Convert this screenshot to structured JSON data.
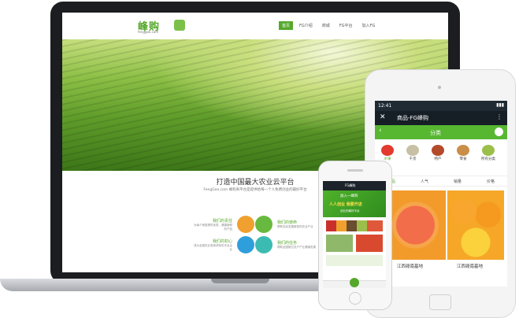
{
  "site": {
    "logo_text": "峰购",
    "logo_sub": "fenggoo.com",
    "nav": [
      "首页",
      "FG介绍",
      "商城",
      "FG平台",
      "加入FG"
    ],
    "tagline": "打造中国最大农业云平台",
    "subline": "FengGoo.com 峰购商平台是提供给每一个人免费创业的最好平台",
    "features": [
      {
        "title": "我们的责任",
        "desc": "为每个家庭提供优质、健康新鲜的产品"
      },
      {
        "title": "我们的使命",
        "desc": "帮助农民发展新型的农业产业"
      },
      {
        "title": "我们的初心",
        "desc": "成为全国农业电商领军的平台企业"
      },
      {
        "title": "我们的任务",
        "desc": "帮助全国数亿农户产业健康发展"
      }
    ],
    "colors": {
      "brand": "#56a82b",
      "orange": "#f0a02e",
      "teal": "#3bbbb1",
      "blue": "#2f9fdc",
      "green": "#68b93f"
    }
  },
  "tablet": {
    "time": "12:41",
    "title": "商品-FG峰购",
    "section": "分类",
    "categories": [
      "水果",
      "干货",
      "特产",
      "零食",
      "所有分类"
    ],
    "tabs": [
      "商品",
      "人气",
      "销量",
      "价格"
    ],
    "products": [
      "江西赣南基地",
      "江西赣南基地"
    ]
  },
  "phone": {
    "title": "FG峰购",
    "banner_line1": "加入一峰购",
    "banner_line2": "人人创业 我要开店",
    "banner_sub": "创业的最好平台"
  }
}
